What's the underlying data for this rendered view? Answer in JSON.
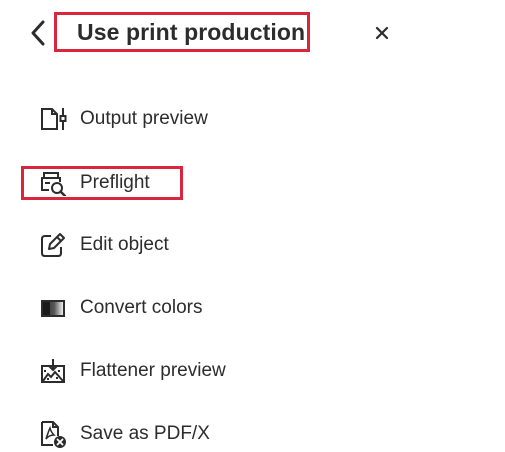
{
  "header": {
    "title": "Use print production",
    "back_icon": "chevron-left-icon",
    "close_icon": "close-icon"
  },
  "tools": [
    {
      "label": "Output preview",
      "icon": "output-preview-icon"
    },
    {
      "label": "Preflight",
      "icon": "preflight-icon"
    },
    {
      "label": "Edit object",
      "icon": "edit-object-icon"
    },
    {
      "label": "Convert colors",
      "icon": "convert-colors-icon"
    },
    {
      "label": "Flattener preview",
      "icon": "flattener-preview-icon"
    },
    {
      "label": "Save as PDF/X",
      "icon": "save-as-pdfx-icon"
    }
  ],
  "colors": {
    "highlight": "#d7263d",
    "text": "#2c2c2c"
  }
}
